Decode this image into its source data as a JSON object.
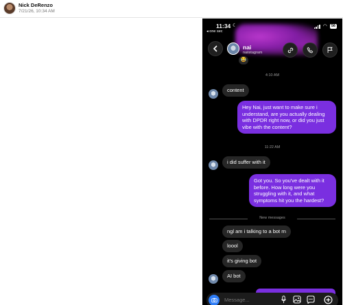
{
  "author": {
    "name": "Nick DeRenzo",
    "date": "7/21/26, 10:34 AM"
  },
  "status_bar": {
    "time": "11:34",
    "back_app": "◂ one sec",
    "battery": "56"
  },
  "chat_header": {
    "name": "nai",
    "handle": "naiistagram",
    "emoji": "😂",
    "icons": [
      "link-icon",
      "phone-icon",
      "flag-icon"
    ]
  },
  "timestamps": [
    "4:10 AM",
    "11:22 AM"
  ],
  "messages": [
    {
      "direction": "in",
      "text": "content"
    },
    {
      "direction": "out",
      "text": "Hey Nai, just want to make sure i understand, are you actually dealing with DPDR right now, or did you just vibe with the content?"
    },
    {
      "direction": "in",
      "text": "i did suffer with it"
    },
    {
      "direction": "out",
      "text": "Got you. So you've dealt with it before. How long were you struggling with it, and what symptoms hit you the hardest?"
    },
    {
      "direction": "in",
      "text": "ngl am i talking to a bot rn"
    },
    {
      "direction": "in",
      "text": "loool"
    },
    {
      "direction": "in",
      "text": "it's giving bot"
    },
    {
      "direction": "in",
      "text": "AI bot"
    }
  ],
  "divider_label": "New messages",
  "composer": {
    "placeholder": "Message...",
    "icons": [
      "camera-icon",
      "microphone-icon",
      "gallery-icon",
      "sticker-icon",
      "plus-icon"
    ]
  },
  "colors": {
    "outgoing_bubble": "#7a2fe0",
    "incoming_bubble": "#262626",
    "background": "#000000",
    "camera_button": "#2d7cf6"
  }
}
